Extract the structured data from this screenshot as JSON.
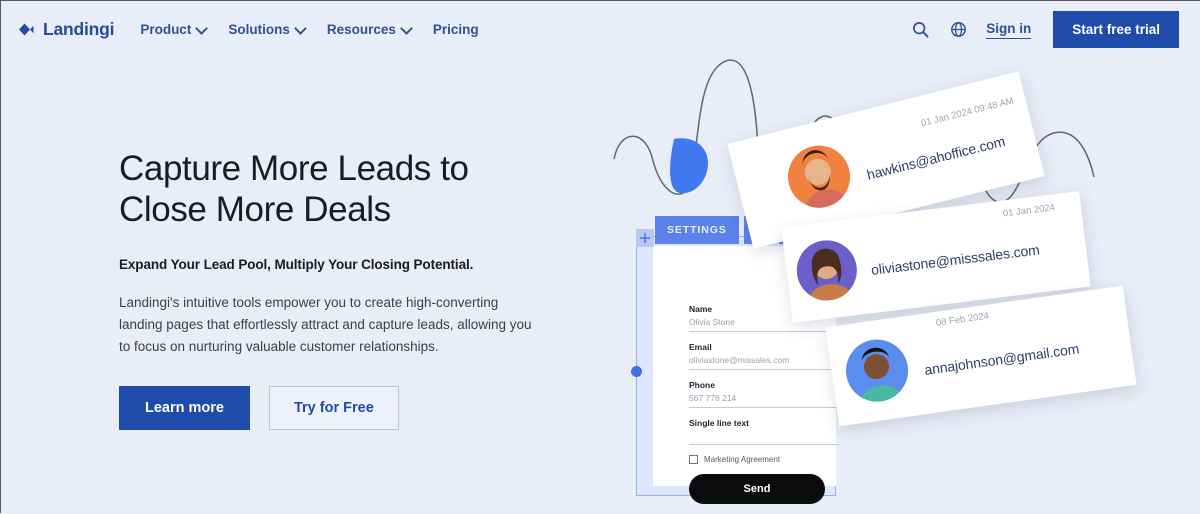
{
  "brand": {
    "name": "Landingi",
    "logo_icon": "landingi-diamond-icon",
    "primary_color": "#1f4bab",
    "nav_text_color": "#2f5196",
    "background_color": "#e9edf8"
  },
  "header": {
    "nav_items": [
      {
        "label": "Product",
        "has_dropdown": true
      },
      {
        "label": "Solutions",
        "has_dropdown": true
      },
      {
        "label": "Resources",
        "has_dropdown": true
      },
      {
        "label": "Pricing",
        "has_dropdown": false
      }
    ],
    "search_icon": "search-icon",
    "language_icon": "globe-icon",
    "signin_label": "Sign in",
    "cta_label": "Start free trial"
  },
  "hero": {
    "title_line1": "Capture More Leads to",
    "title_line2": "Close More Deals",
    "subtitle": "Expand Your Lead Pool, Multiply Your Closing Potential.",
    "body": "Landingi's intuitive tools empower you to create high-converting landing pages that effortlessly attract and capture leads, allowing you to focus on nurturing valuable customer relationships.",
    "primary_button": "Learn more",
    "secondary_button": "Try for Free"
  },
  "builder": {
    "toolbar": {
      "settings_label": "SETTINGS",
      "icons": [
        "add-section-icon",
        "duplicate-icon",
        "trash-icon"
      ],
      "move_handle_icon": "move-handle-icon"
    },
    "fields": [
      {
        "label": "Name",
        "value": "Olivia Stone"
      },
      {
        "label": "Email",
        "value": "oliviastone@missales.com"
      },
      {
        "label": "Phone",
        "value": "567 778 214"
      },
      {
        "label": "Single line text",
        "value": ""
      }
    ],
    "checkbox_label": "Marketing Agreement",
    "submit_label": "Send"
  },
  "lead_cards": [
    {
      "email": "hawkins@ahoffice.com",
      "timestamp": "01 Jan 2024 09:48 AM",
      "avatar_name": "avatar-hawkins",
      "avatar_bg": "#f0813f"
    },
    {
      "email": "oliviastone@misssales.com",
      "timestamp": "01 Jan 2024",
      "avatar_name": "avatar-olivia-stone",
      "avatar_bg": "#6b5fc9"
    },
    {
      "email": "annajohnson@gmail.com",
      "timestamp": "08 Feb 2024",
      "avatar_name": "avatar-anna-johnson",
      "avatar_bg": "#5b8def"
    }
  ]
}
